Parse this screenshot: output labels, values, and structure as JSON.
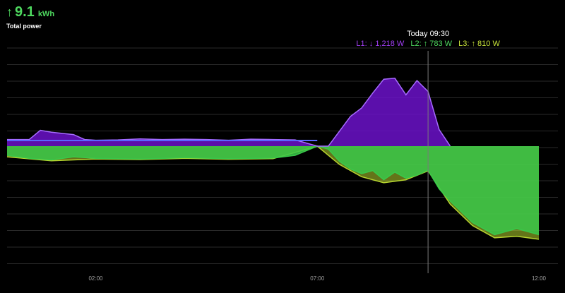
{
  "total": {
    "arrow": "↑",
    "value": "9.1",
    "unit": "kWh",
    "label": "Total power"
  },
  "tooltip": {
    "title": "Today 09:30",
    "entries": [
      {
        "name": "L1:",
        "arrow": "↓",
        "value": "1,218 W",
        "color": "#a23ff6"
      },
      {
        "name": "L2:",
        "arrow": "↑",
        "value": "783 W",
        "color": "#4ed85f"
      },
      {
        "name": "L3:",
        "arrow": "↑",
        "value": "810 W",
        "color": "#c7e23a"
      }
    ]
  },
  "colors": {
    "background": "#000000",
    "grid": "#2a2a2a",
    "l1_fill": "#6b12c9",
    "l1_line": "#a66bff",
    "base_line": "#5a66ff",
    "l2_fill": "#39c84a",
    "l3_fill": "#b6d42e",
    "cursor": "#7a7a7a"
  },
  "chart_data": {
    "type": "area",
    "stacked": false,
    "x_ticks": [
      "02:00",
      "07:00",
      "12:00"
    ],
    "x_domain": [
      "00:00",
      "12:00"
    ],
    "cursor_time": "09:30",
    "y_range": [
      -4000,
      2600
    ],
    "series": [
      {
        "name": "L1",
        "sign": "positive",
        "time": [
          "00:00",
          "00:30",
          "00:45",
          "01:00",
          "01:30",
          "01:45",
          "02:00",
          "02:30",
          "03:00",
          "03:30",
          "04:00",
          "04:30",
          "05:00",
          "05:30",
          "06:00",
          "06:30",
          "07:00",
          "07:15",
          "07:30",
          "07:45",
          "08:00",
          "08:15",
          "08:30",
          "08:45",
          "09:00",
          "09:15",
          "09:30",
          "09:45",
          "10:00"
        ],
        "values": [
          200,
          200,
          480,
          420,
          350,
          200,
          180,
          190,
          220,
          200,
          210,
          200,
          180,
          210,
          200,
          190,
          0,
          0,
          450,
          900,
          1150,
          1600,
          2020,
          2050,
          1550,
          1980,
          1650,
          500,
          0
        ]
      },
      {
        "name": "L2",
        "sign": "negative",
        "time": [
          "00:00",
          "00:30",
          "01:00",
          "01:30",
          "02:00",
          "03:00",
          "04:00",
          "05:00",
          "06:00",
          "06:30",
          "07:00",
          "07:15",
          "07:30",
          "07:45",
          "08:00",
          "08:15",
          "08:30",
          "08:45",
          "09:00",
          "09:15",
          "09:30",
          "09:45",
          "10:00",
          "10:30",
          "11:00",
          "11:30",
          "12:00"
        ],
        "values": [
          -300,
          -400,
          -450,
          -350,
          -400,
          -420,
          -380,
          -410,
          -390,
          -300,
          0,
          -100,
          -500,
          -750,
          -900,
          -800,
          -1100,
          -850,
          -1050,
          -950,
          -783,
          -1400,
          -1800,
          -2500,
          -2900,
          -2700,
          -2900
        ]
      },
      {
        "name": "L3",
        "sign": "negative",
        "time": [
          "00:00",
          "01:00",
          "02:00",
          "03:00",
          "04:00",
          "05:00",
          "06:00",
          "07:00",
          "07:30",
          "08:00",
          "08:30",
          "09:00",
          "09:30",
          "10:00",
          "10:30",
          "11:00",
          "11:30",
          "12:00"
        ],
        "values": [
          -350,
          -480,
          -420,
          -440,
          -400,
          -430,
          -410,
          0,
          -600,
          -1000,
          -1200,
          -1100,
          -810,
          -1900,
          -2600,
          -3000,
          -2950,
          -3050
        ]
      }
    ]
  }
}
